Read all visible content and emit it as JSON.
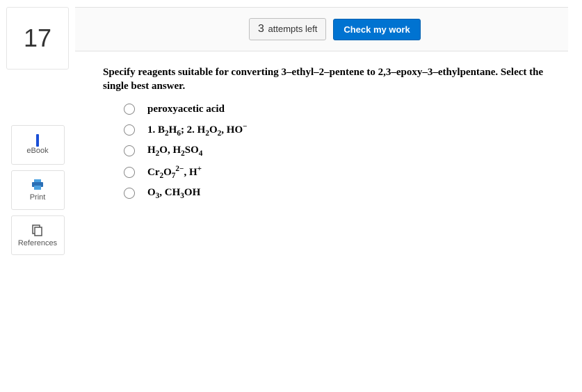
{
  "question_number": "17",
  "sidebar": {
    "ebook_label": "eBook",
    "print_label": "Print",
    "references_label": "References"
  },
  "toolbar": {
    "attempts_count": "3",
    "attempts_text": "attempts left",
    "check_label": "Check my work"
  },
  "prompt": "Specify reagents suitable for converting 3–ethyl–2–pentene to 2,3–epoxy–3–ethylpentane. Select the single best answer.",
  "options": [
    {
      "html": "peroxyacetic acid"
    },
    {
      "html": "1. B<sub>2</sub>H<sub>6</sub>; 2. H<sub>2</sub>O<sub>2</sub>, HO<sup>−</sup>"
    },
    {
      "html": "H<sub>2</sub>O, H<sub>2</sub>SO<sub>4</sub>"
    },
    {
      "html": "Cr<sub>2</sub>O<sub>7</sub><sup>2−</sup>, H<sup>+</sup>"
    },
    {
      "html": "O<sub>3</sub>, CH<sub>3</sub>OH"
    }
  ]
}
